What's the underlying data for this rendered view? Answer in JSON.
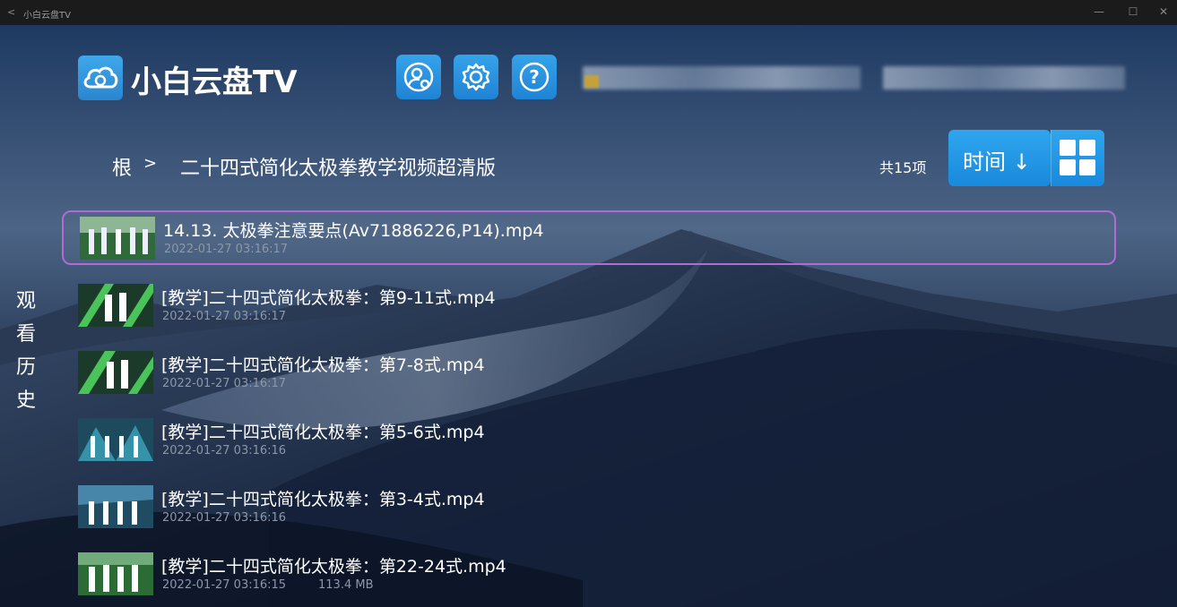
{
  "window": {
    "back_glyph": "<",
    "title": "小白云盘TV",
    "minimize_glyph": "—",
    "maximize_glyph": "☐",
    "close_glyph": "✕"
  },
  "header": {
    "app_name": "小白云盘TV",
    "buttons": [
      {
        "icon": "user-settings-icon"
      },
      {
        "icon": "gear-icon"
      },
      {
        "icon": "help-icon",
        "glyph": "?"
      }
    ],
    "account_text_redacted": true
  },
  "breadcrumb": {
    "root": "根",
    "separator": ">",
    "folder": "二十四式简化太极拳教学视频超清版"
  },
  "toolbar": {
    "count_label": "共15项",
    "sort_label": "时间 ↓",
    "view_icon": "grid-view-icon"
  },
  "sidebar": {
    "history_chars": [
      "观",
      "看",
      "历",
      "史"
    ]
  },
  "files": [
    {
      "name": "14.13. 太极拳注意要点(Av71886226,P14).mp4",
      "date": "2022-01-27 03:16:17",
      "size": "",
      "selected": true
    },
    {
      "name": "[教学]二十四式简化太极拳：第9-11式.mp4",
      "date": "2022-01-27 03:16:17",
      "size": ""
    },
    {
      "name": "[教学]二十四式简化太极拳：第7-8式.mp4",
      "date": "2022-01-27 03:16:17",
      "size": ""
    },
    {
      "name": "[教学]二十四式简化太极拳：第5-6式.mp4",
      "date": "2022-01-27 03:16:16",
      "size": ""
    },
    {
      "name": "[教学]二十四式简化太极拳：第3-4式.mp4",
      "date": "2022-01-27 03:16:16",
      "size": ""
    },
    {
      "name": "[教学]二十四式简化太极拳：第22-24式.mp4",
      "date": "2022-01-27 03:16:15",
      "size": "113.4 MB"
    }
  ],
  "colors": {
    "accent": "#2a9be6",
    "selection": "#b16ad8",
    "meta_text": "#8c97a8"
  }
}
